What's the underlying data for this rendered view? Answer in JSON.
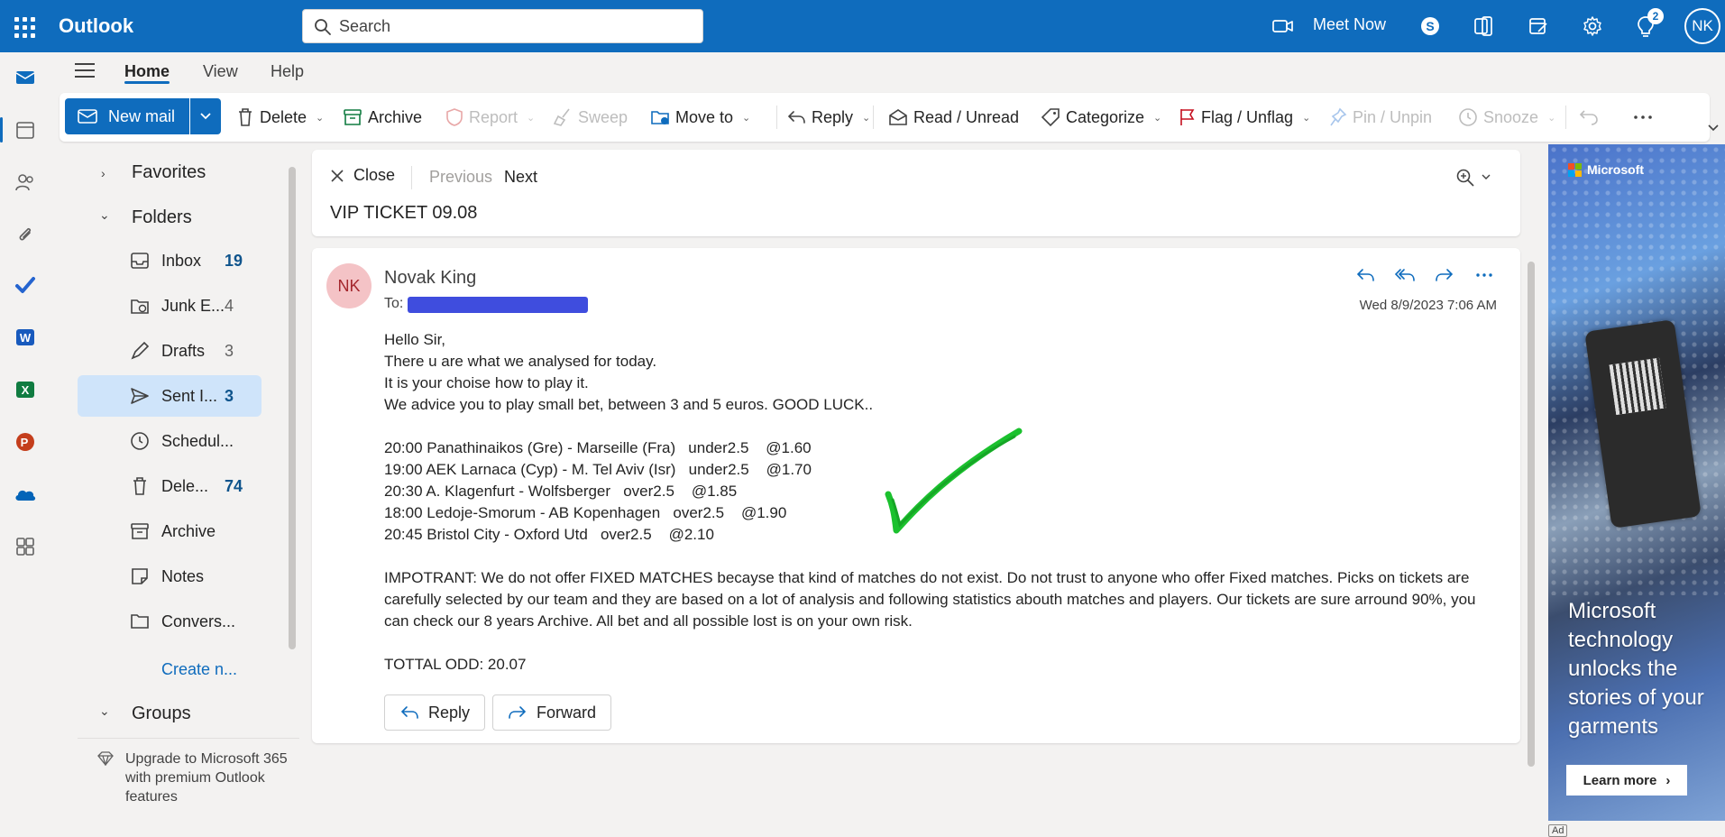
{
  "app": {
    "brand": "Outlook",
    "accent_color": "#0f6cbd"
  },
  "topbar": {
    "search_placeholder": "Search",
    "meet_now_label": "Meet Now",
    "notification_count": "2",
    "user_initials": "NK"
  },
  "ribbon": {
    "tabs": [
      {
        "label": "Home",
        "active": true
      },
      {
        "label": "View",
        "active": false
      },
      {
        "label": "Help",
        "active": false
      }
    ]
  },
  "toolbar": {
    "new_mail": "New mail",
    "delete": "Delete",
    "archive": "Archive",
    "report": "Report",
    "sweep": "Sweep",
    "move_to": "Move to",
    "reply": "Reply",
    "read_unread": "Read / Unread",
    "categorize": "Categorize",
    "flag_unflag": "Flag / Unflag",
    "pin_unpin": "Pin / Unpin",
    "snooze": "Snooze"
  },
  "folders": {
    "favorites_label": "Favorites",
    "folders_label": "Folders",
    "items": [
      {
        "label": "Inbox",
        "count": "19",
        "icon": "inbox-icon"
      },
      {
        "label": "Junk E...",
        "count": "4",
        "icon": "junk-icon"
      },
      {
        "label": "Drafts",
        "count": "3",
        "icon": "drafts-icon"
      },
      {
        "label": "Sent I...",
        "count": "3",
        "icon": "sent-icon"
      },
      {
        "label": "Schedul...",
        "count": "",
        "icon": "clock-icon"
      },
      {
        "label": "Dele...",
        "count": "74",
        "icon": "trash-icon"
      },
      {
        "label": "Archive",
        "count": "",
        "icon": "archive-icon"
      },
      {
        "label": "Notes",
        "count": "",
        "icon": "notes-icon"
      },
      {
        "label": "Convers...",
        "count": "",
        "icon": "folder-icon"
      }
    ],
    "create_new": "Create n...",
    "groups_label": "Groups",
    "upgrade_text": "Upgrade to Microsoft 365 with premium Outlook features"
  },
  "reading": {
    "close_label": "Close",
    "previous_label": "Previous",
    "next_label": "Next",
    "subject": "VIP TICKET 09.08"
  },
  "message": {
    "sender_initials": "NK",
    "sender_name": "Novak King",
    "to_label": "To:",
    "date": "Wed 8/9/2023 7:06 AM",
    "body": {
      "l1": "Hello Sir,",
      "l2": "There u are what we analysed for today.",
      "l3": "It is your choise how to play it.",
      "l4": "We advice you to play small bet, between 3 and 5 euros. GOOD LUCK..",
      "m1": "20:00 Panathinaikos (Gre) - Marseille (Fra)   under2.5    @1.60",
      "m2": "19:00 AEK Larnaca (Cyp) - M. Tel Aviv (Isr)   under2.5    @1.70",
      "m3": "20:30 A. Klagenfurt - Wolfsberger   over2.5    @1.85",
      "m4": "18:00 Ledoje-Smorum - AB Kopenhagen   over2.5    @1.90",
      "m5": "20:45 Bristol City - Oxford Utd   over2.5    @2.10",
      "important": "IMPOTRANT: We do not offer FIXED MATCHES becayse that kind of matches do not exist. Do not trust to anyone who offer Fixed matches. Picks on tickets are carefully selected by our team and they are based on a lot of analysis and following statistics abouth matches and players. Our tickets are sure arround 90%, you can check our 8 years Archive. All bet and all possible lost is on your own risk.",
      "total": "TOTTAL ODD: 20.07"
    },
    "reply_label": "Reply",
    "forward_label": "Forward"
  },
  "ad": {
    "brand": "Microsoft",
    "headline": "Microsoft technology unlocks the stories of your garments",
    "cta": "Learn more",
    "tag": "Ad"
  }
}
